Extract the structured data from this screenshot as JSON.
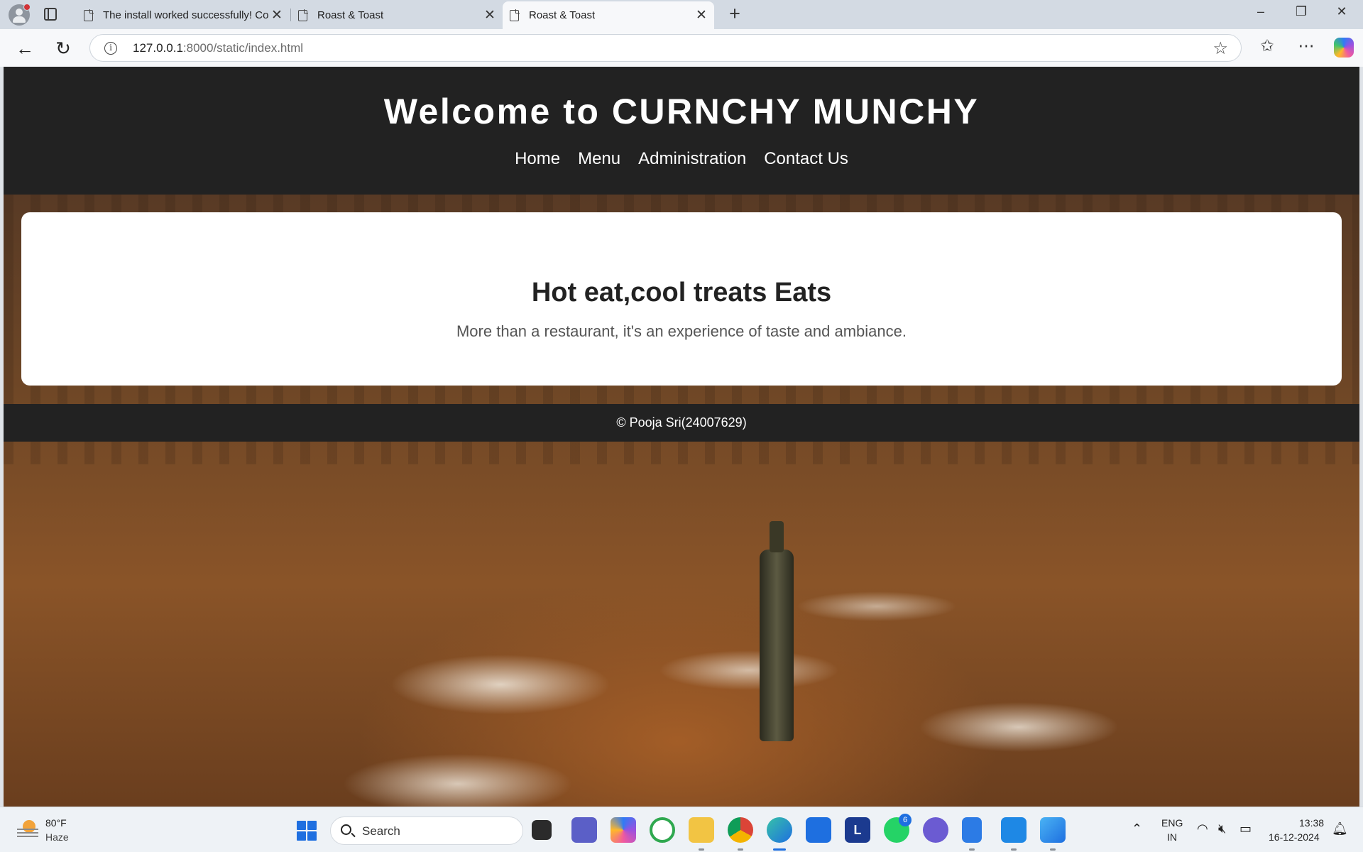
{
  "browser": {
    "tabs": [
      {
        "title": "The install worked successfully! Co",
        "active": false
      },
      {
        "title": "Roast & Toast",
        "active": false
      },
      {
        "title": "Roast & Toast",
        "active": true
      }
    ],
    "new_tab_glyph": "+",
    "close_glyph": "✕",
    "window_controls": [
      "–",
      "❐",
      "✕"
    ],
    "url_host": "127.0.0.1",
    "url_rest": ":8000/static/index.html",
    "icons": [
      "back-icon",
      "refresh-icon",
      "info-icon",
      "star-icon",
      "favorites-icon",
      "more-icon",
      "copilot-icon"
    ]
  },
  "site": {
    "title": "Welcome to CURNCHY MUNCHY",
    "nav": [
      "Home",
      "Menu",
      "Administration",
      "Contact Us"
    ],
    "hero_title": "Hot eat,cool treats Eats",
    "hero_text": "More than a restaurant, it's an experience of taste and ambiance.",
    "footer": "© Pooja Sri(24007629)",
    "colors": {
      "header_bg": "#222222",
      "card_bg": "#ffffff",
      "heading": "#222222",
      "body_text": "#555555"
    }
  },
  "taskbar": {
    "weather_temp": "80°F",
    "weather_desc": "Haze",
    "search_label": "Search",
    "whatsapp_badge": "6",
    "app_L_glyph": "L",
    "lang_line1": "ENG",
    "lang_line2": "IN",
    "time": "13:38",
    "date": "16-12-2024",
    "icons": [
      "start-icon",
      "task-view-icon",
      "teams-icon",
      "copilot-icon",
      "sync-icon",
      "file-explorer-icon",
      "chrome-icon",
      "edge-icon",
      "store-icon",
      "app-l-icon",
      "whatsapp-icon",
      "vpn-icon",
      "notepad-icon",
      "vscode-icon",
      "photos-icon",
      "chevron-up-icon",
      "wifi-icon",
      "mute-icon",
      "battery-icon",
      "bell-icon"
    ]
  }
}
